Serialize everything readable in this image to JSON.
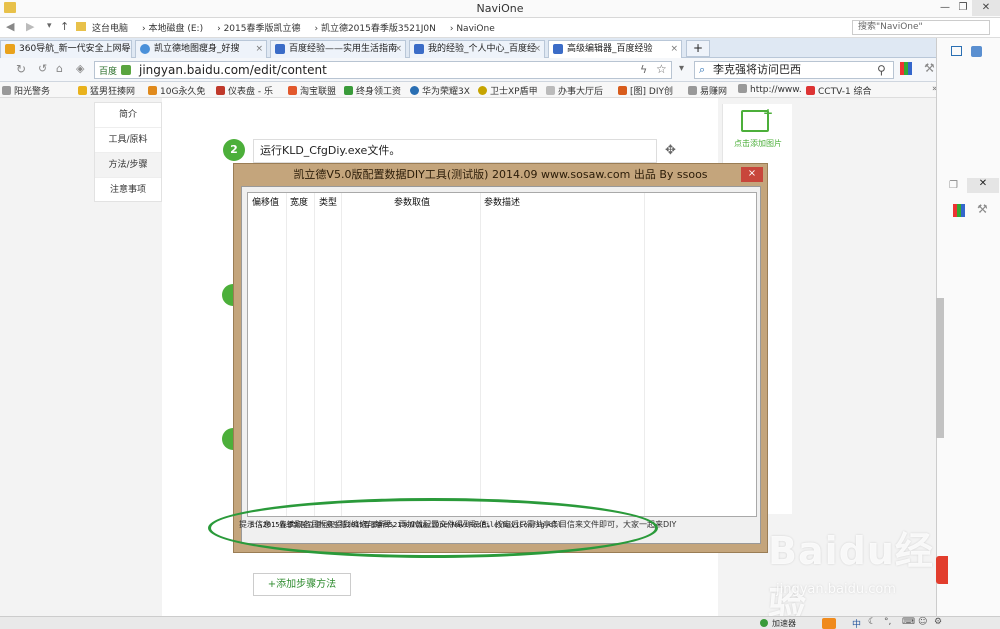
{
  "explorer": {
    "title": "NaviOne",
    "breadcrumbs": [
      "这台电脑",
      "本地磁盘 (E:)",
      "2015春季版凯立德",
      "凯立德2015春季版3521J0N",
      "NaviOne"
    ],
    "search_placeholder": "搜索\"NaviOne\""
  },
  "browser": {
    "tabs": [
      {
        "label": "360导航_新一代安全上网导",
        "icon_color": "#e9a21c"
      },
      {
        "label": "凯立德地图瘦身_好搜",
        "icon_color": "#4a90d9"
      },
      {
        "label": "百度经验——实用生活指南",
        "icon_color": "#3b6cc7"
      },
      {
        "label": "我的经验_个人中心_百度经",
        "icon_color": "#3b6cc7"
      },
      {
        "label": "高级编辑器_百度经验",
        "icon_color": "#3b6cc7"
      }
    ],
    "site_label": "百度",
    "url": "jingyan.baidu.com/edit/content",
    "web_search_value": "李克强将访问巴西",
    "bookmarks": [
      "阳光警务",
      "猛男狂揍网",
      "10G永久免",
      "仪表盘 - 乐",
      "淘宝联盟",
      "终身领工资",
      "华为荣耀3X",
      "卫士XP盾甲",
      "办事大厅后",
      "[图] DIY创",
      "易赚网",
      "http://www.",
      "CCTV-1 综合"
    ]
  },
  "page": {
    "nav": [
      "简介",
      "工具/原料",
      "方法/步骤",
      "注意事项"
    ],
    "step_number": "2",
    "step_text": "运行KLD_CfgDiy.exe文件。",
    "add_step_label": "+添加步骤方法",
    "add_image_label": "点击添加图片"
  },
  "dialog": {
    "title": "凯立德V5.0版配置数据DIY工具(测试版) 2014.09  www.sosaw.com 出品 By ssoos",
    "close": "×",
    "columns": [
      "偏移值",
      "宽度",
      "类型",
      "参数取值",
      "参数描述"
    ],
    "path": "E:\\2015春季新凯立德\\凯立德2015春季新3521J0N\\NaviOne\\NaviResFile\\NaviConfig.dll",
    "tip": "提示信息：先读取各目框架得到编修与解释，再加载配置文件得到取值，按定后只需共享条目信来文件即可，大家一起来DIY"
  },
  "taskbar": {
    "accelerate": "加速器",
    "ime": "中"
  },
  "watermark": {
    "brand": "Baidu经验",
    "site": "jingyan.baidu.com"
  },
  "colors": {
    "accent_green": "#4caf3a",
    "dialog_frame": "#c4a57c",
    "close_red": "#c8463b",
    "annotation_ellipse": "#2a9a3a"
  }
}
